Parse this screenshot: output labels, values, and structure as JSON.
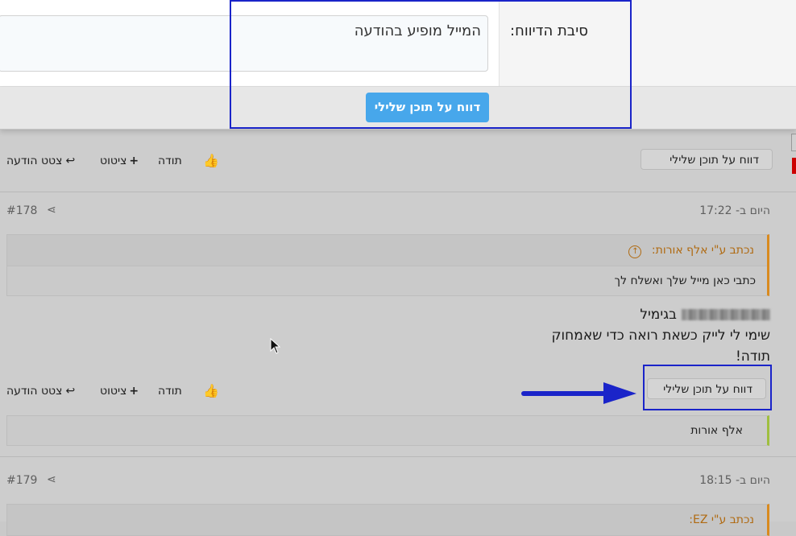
{
  "dialog": {
    "reason_label": "סיבת הדיווח:",
    "reason_value": "המייל מופיע בהודעה",
    "submit_label": "דווח על תוכן שלילי"
  },
  "post_prev": {
    "report_label": "דווח על תוכן שלילי",
    "actions": {
      "quote_post": "צטט הודעה",
      "quote": "ציטוט",
      "thanks": "תודה"
    }
  },
  "post_178": {
    "time": "היום ב- 17:22",
    "number": "#178",
    "quote_author": "נכתב ע\"י אלף אורות:",
    "quote_text": "כתבי כאן מייל שלך ואשלח לך",
    "message_lines": [
      "בגימיל",
      "שימי לי לייק כשאת רואה כדי שאמחוק",
      "תודה!"
    ],
    "report_label": "דווח על תוכן שלילי",
    "actions": {
      "quote_post": "צטט הודעה",
      "quote": "ציטוט",
      "thanks": "תודה"
    },
    "signature": "אלף אורות"
  },
  "post_179": {
    "time": "היום ב- 18:15",
    "number": "#179",
    "quote_author": "נכתב ע\"י EZ:"
  },
  "colors": {
    "highlight": "#1a24c9",
    "submit_bg": "#47a7eb",
    "quote_accent": "#d98a1f",
    "signature_accent": "#9fbf3f"
  }
}
